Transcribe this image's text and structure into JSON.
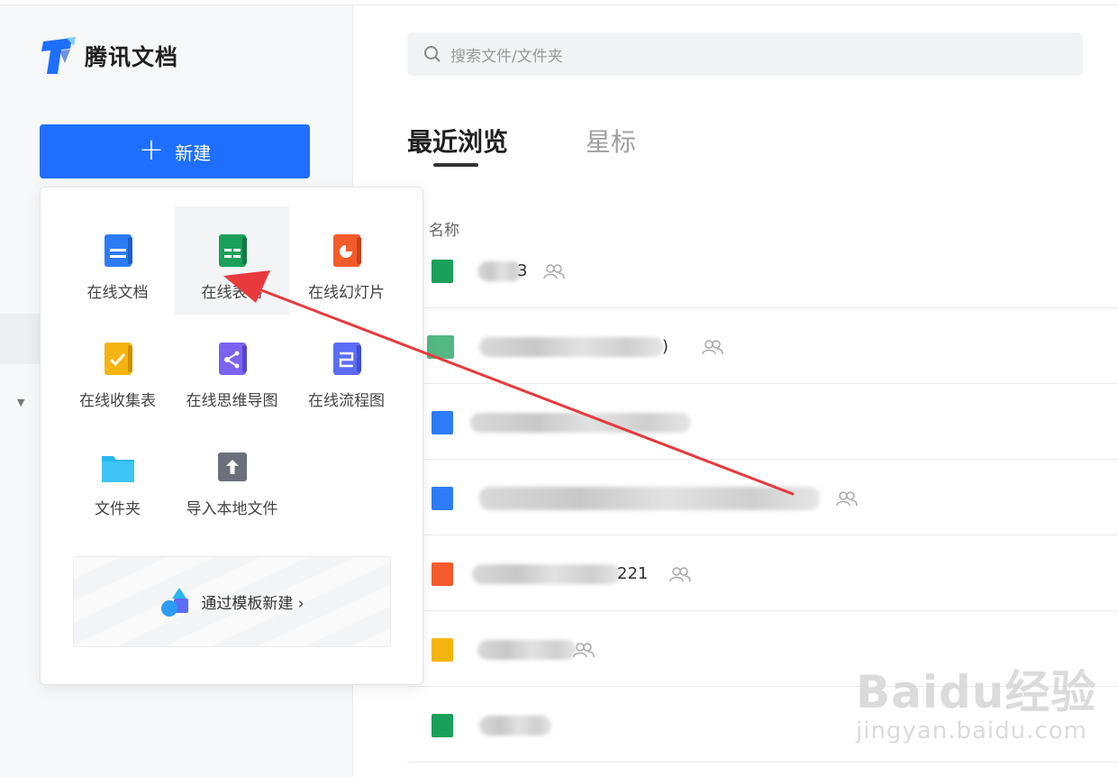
{
  "app": {
    "logo_text": "腾讯文档"
  },
  "sidebar": {
    "new_button_label": "新建"
  },
  "new_menu": {
    "items": [
      {
        "label": "在线文档",
        "icon": "doc-icon",
        "color": "#2d7cf6"
      },
      {
        "label": "在线表格",
        "icon": "sheet-icon",
        "color": "#19a05a"
      },
      {
        "label": "在线幻灯片",
        "icon": "slide-icon",
        "color": "#f35b2b"
      },
      {
        "label": "在线收集表",
        "icon": "form-icon",
        "color": "#f5b40f"
      },
      {
        "label": "在线思维导图",
        "icon": "mindmap-icon",
        "color": "#7b63f0"
      },
      {
        "label": "在线流程图",
        "icon": "flowchart-icon",
        "color": "#5b6cf5"
      },
      {
        "label": "文件夹",
        "icon": "folder-icon",
        "color": "#29b6f0"
      },
      {
        "label": "导入本地文件",
        "icon": "upload-icon",
        "color": "#6a6f7a"
      }
    ],
    "template_label": "通过模板新建 ›"
  },
  "search": {
    "placeholder": "搜索文件/文件夹"
  },
  "tabs": {
    "recent": "最近浏览",
    "starred": "星标"
  },
  "list": {
    "column_name": "名称",
    "rows": [
      {
        "type": "sheet",
        "visible_text": "3",
        "shared": true
      },
      {
        "type": "sheet",
        "visible_text": ")",
        "shared": true
      },
      {
        "type": "doc",
        "visible_text": "",
        "shared": false
      },
      {
        "type": "doc",
        "visible_text": "",
        "shared": true
      },
      {
        "type": "slide",
        "visible_text": "221",
        "shared": true
      },
      {
        "type": "form",
        "visible_text": "",
        "shared": true
      },
      {
        "type": "sheet",
        "visible_text": "",
        "shared": false
      }
    ]
  },
  "watermark": {
    "main": "Baidu经验",
    "sub": "jingyan.baidu.com"
  },
  "colors": {
    "accent": "#1e6fff",
    "arrow": "#e8393c"
  }
}
